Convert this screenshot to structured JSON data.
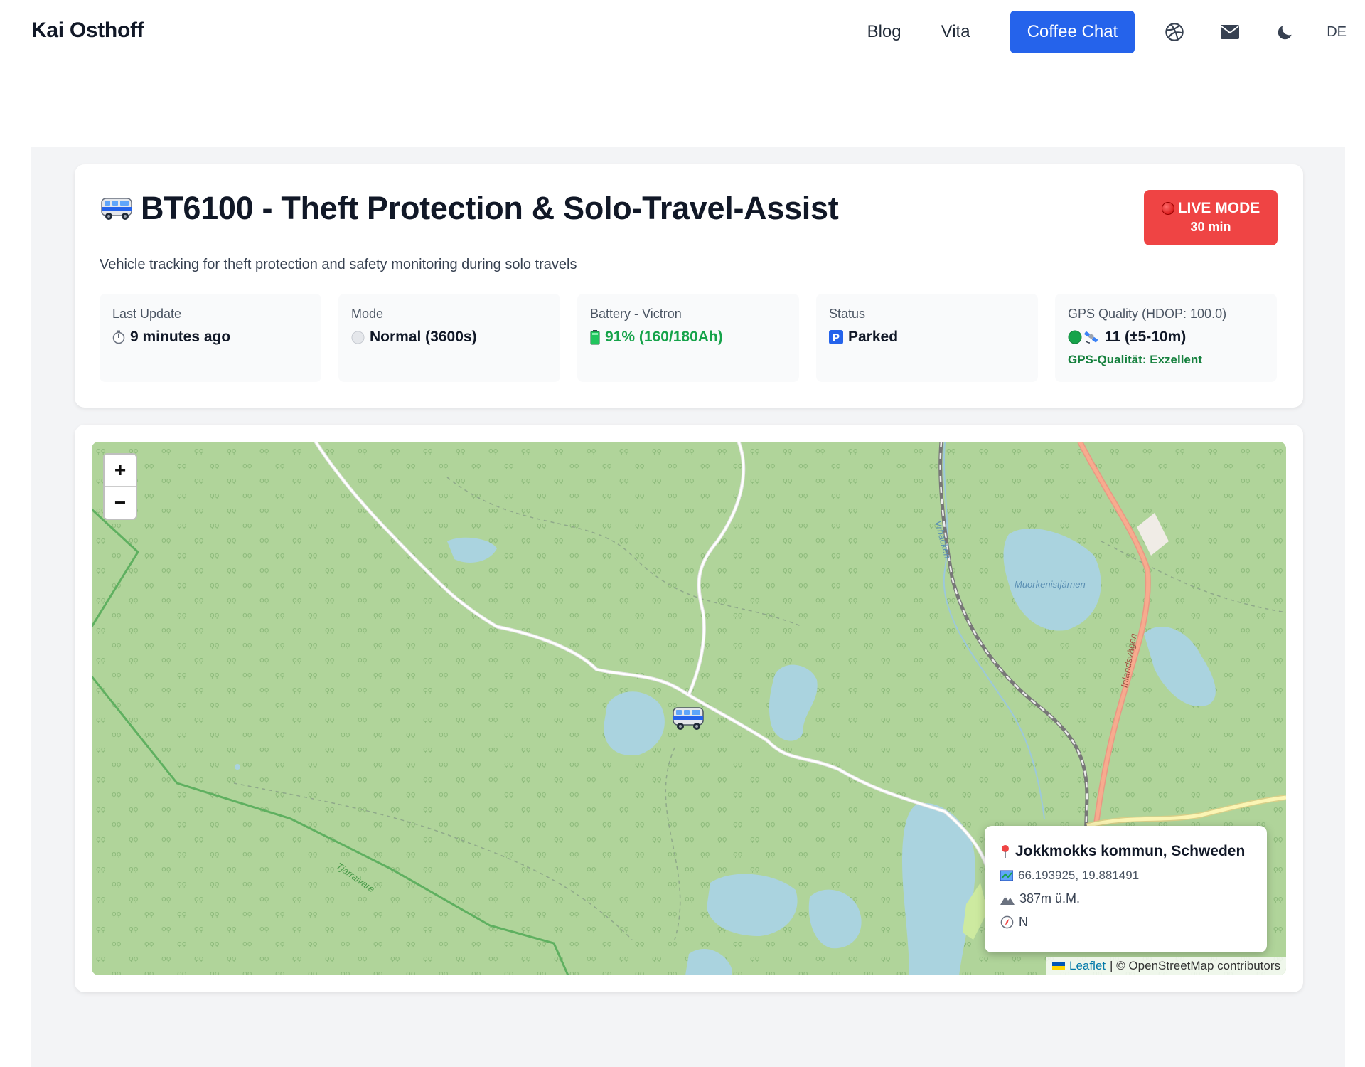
{
  "header": {
    "brand": "Kai Osthoff",
    "nav": {
      "blog": "Blog",
      "vita": "Vita",
      "coffee_chat": "Coffee Chat",
      "lang": "DE"
    },
    "icons": [
      "dribbble-icon",
      "mail-icon",
      "moon-icon"
    ]
  },
  "tracker": {
    "title": "BT6100 - Theft Protection & Solo-Travel-Assist",
    "subtitle": "Vehicle tracking for theft protection and safety monitoring during solo travels",
    "live_badge": {
      "line1": "LIVE MODE",
      "line2": "30 min"
    },
    "stats": {
      "last_update": {
        "label": "Last Update",
        "value": "9 minutes ago"
      },
      "mode": {
        "label": "Mode",
        "value": "Normal (3600s)"
      },
      "battery": {
        "label": "Battery - Victron",
        "value": "91% (160/180Ah)"
      },
      "status": {
        "label": "Status",
        "value": "Parked"
      },
      "gps": {
        "label": "GPS Quality (HDOP: 100.0)",
        "value": "11 (±5-10m)",
        "note": "GPS-Qualität: Exzellent"
      }
    }
  },
  "map": {
    "zoom_in": "+",
    "zoom_out": "−",
    "popup": {
      "place": "Jokkmokks kommun, Schweden",
      "coords": "66.193925, 19.881491",
      "altitude": "387m ü.M.",
      "heading": "N"
    },
    "labels": {
      "stream": "Vrbäcken",
      "lake": "Muorkenistjärnen",
      "road": "Inlandsvägen",
      "area": "Tjarraivare"
    },
    "attribution": {
      "leaflet": "Leaflet",
      "osm": "| © OpenStreetMap contributors"
    }
  },
  "colors": {
    "accent": "#2563eb",
    "live": "#ef4444",
    "positive": "#16a34a",
    "map_bg": "#b0d49a",
    "water": "#aad3df"
  }
}
